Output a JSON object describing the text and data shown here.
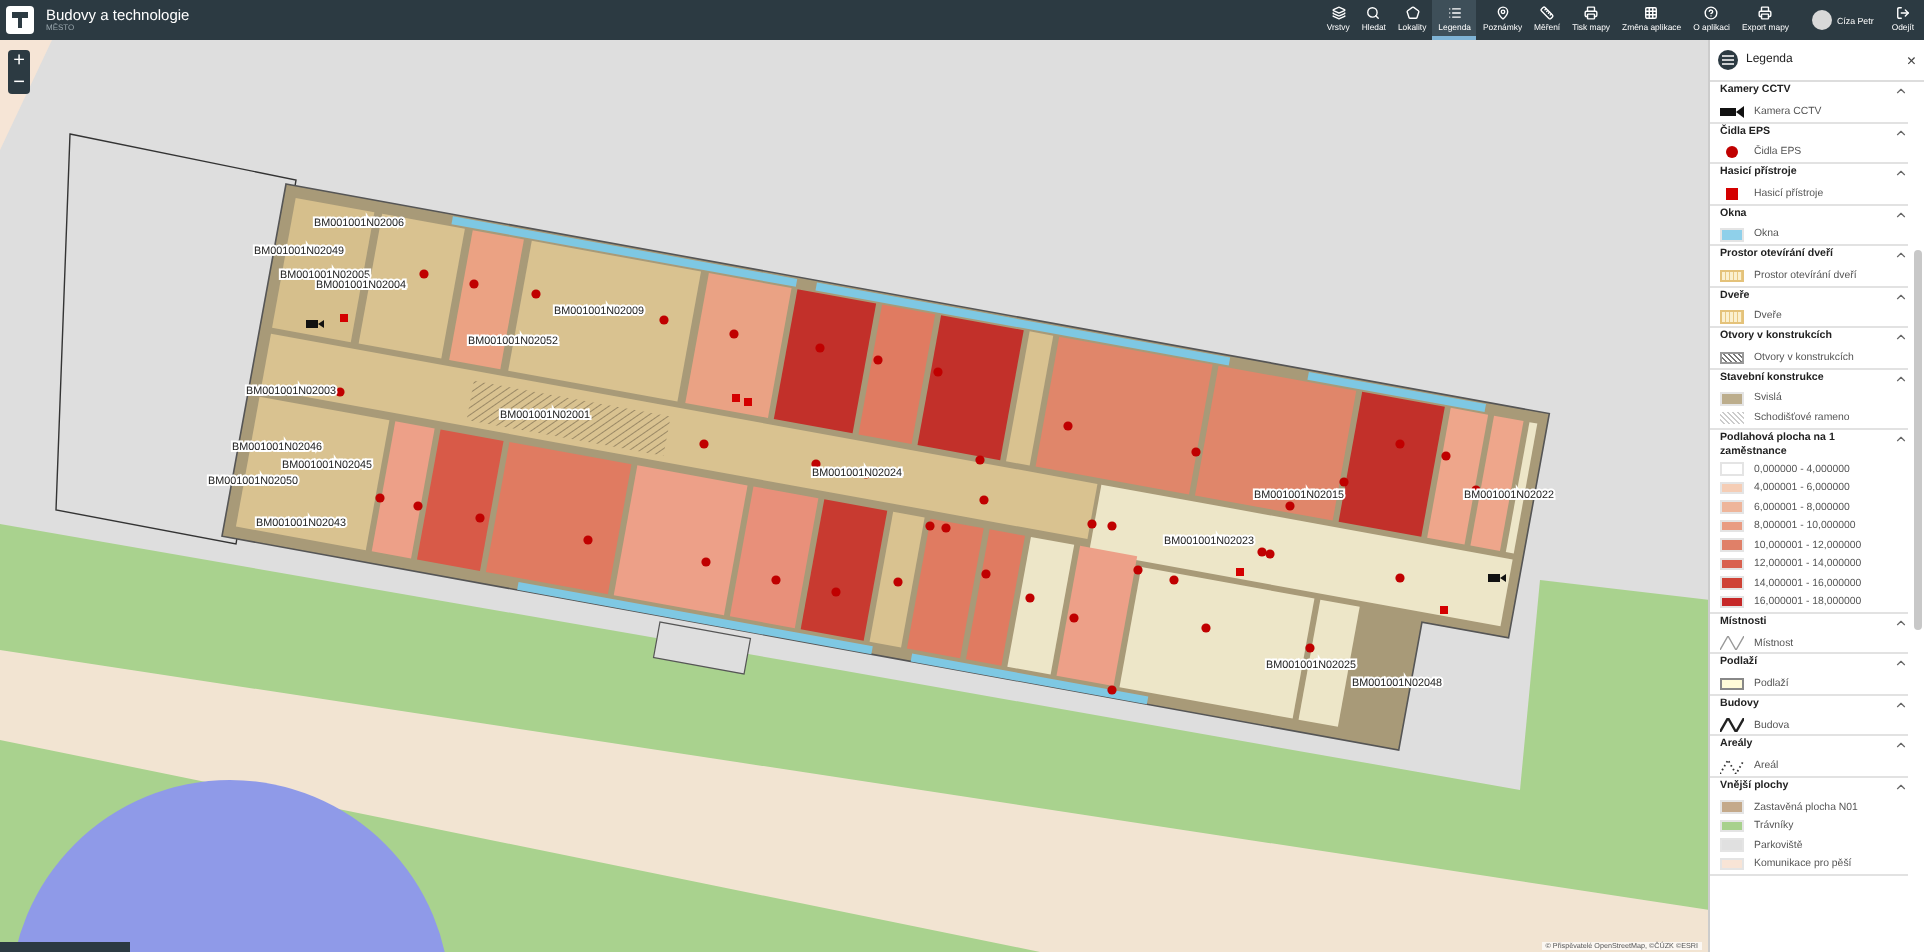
{
  "app": {
    "title": "Budovy a technologie",
    "subtitle": "MĚSTO"
  },
  "toolbar": [
    {
      "label": "Vrstvy",
      "selected": false
    },
    {
      "label": "Hledat",
      "selected": false
    },
    {
      "label": "Lokality",
      "selected": false
    },
    {
      "label": "Legenda",
      "selected": true
    },
    {
      "label": "Poznámky",
      "selected": false
    },
    {
      "label": "Měření",
      "selected": false
    },
    {
      "label": "Tisk mapy",
      "selected": false
    },
    {
      "label": "Změna aplikace",
      "selected": false
    },
    {
      "label": "O aplikaci",
      "selected": false
    },
    {
      "label": "Export mapy",
      "selected": false
    }
  ],
  "user": {
    "name": "Cíza Petr"
  },
  "logout": {
    "label": "Odejít"
  },
  "map": {
    "zoom_controls": [
      "+",
      "−"
    ],
    "room_labels": [
      "BM001001N02006",
      "BM001001N02049",
      "BM001001N02005",
      "BM001001N02004",
      "BM001001N02009",
      "BM001001N02052",
      "BM001001N02003",
      "BM001001N02001",
      "BM001001N02046",
      "BM001001N02045",
      "BM001001N02050",
      "BM001001N02043",
      "BM001001N02024",
      "BM001001N02023",
      "BM001001N02025",
      "BM001001N02048",
      "BM001001N02015",
      "BM001001N02022"
    ],
    "attribution": "© Přispěvatelé OpenStreetMap, ©ČÚZK ©ESRI"
  },
  "legend": {
    "title": "Legenda",
    "close": "×",
    "sections": [
      {
        "title": "Kamery CCTV",
        "expanded": true,
        "items": [
          {
            "kind": "camera",
            "label": "Kamera CCTV"
          }
        ]
      },
      {
        "title": "Čidla EPS",
        "expanded": true,
        "items": [
          {
            "kind": "dot",
            "label": "Čidla EPS",
            "color": "#c00000"
          }
        ]
      },
      {
        "title": "Hasicí přístroje",
        "expanded": true,
        "items": [
          {
            "kind": "square",
            "label": "Hasicí přístroje",
            "color": "#d40000"
          }
        ]
      },
      {
        "title": "Okna",
        "expanded": true,
        "items": [
          {
            "kind": "fill",
            "label": "Okna",
            "color": "#8fd0ea"
          }
        ]
      },
      {
        "title": "Prostor otevírání dveří",
        "expanded": true,
        "items": [
          {
            "kind": "door",
            "label": "Prostor otevírání dveří"
          }
        ]
      },
      {
        "title": "Dveře",
        "expanded": true,
        "items": [
          {
            "kind": "door",
            "label": "Dveře"
          }
        ]
      },
      {
        "title": "Otvory v konstrukcích",
        "expanded": true,
        "items": [
          {
            "kind": "opening",
            "label": "Otvory v konstrukcích"
          }
        ]
      },
      {
        "title": "Stavební konstrukce",
        "expanded": true,
        "items": [
          {
            "kind": "fill",
            "label": "Svislá",
            "color": "#bcad8c"
          },
          {
            "kind": "stair",
            "label": "Schodišťové rameno"
          }
        ]
      },
      {
        "title": "Podlahová plocha na 1 zaměstnance",
        "expanded": true,
        "items": [
          {
            "kind": "fill",
            "label": "0,000000 - 4,000000",
            "color": "#ffffff"
          },
          {
            "kind": "fill",
            "label": "4,000001 - 6,000000",
            "color": "#f5cdb5"
          },
          {
            "kind": "fill",
            "label": "6,000001 - 8,000000",
            "color": "#eeb59a"
          },
          {
            "kind": "fill",
            "label": "8,000001 - 10,000000",
            "color": "#e99c82"
          },
          {
            "kind": "fill",
            "label": "10,000001 - 12,000000",
            "color": "#e08068"
          },
          {
            "kind": "fill",
            "label": "12,000001 - 14,000000",
            "color": "#d9614f"
          },
          {
            "kind": "fill",
            "label": "14,000001 - 16,000000",
            "color": "#cf4236"
          },
          {
            "kind": "fill",
            "label": "16,000001 - 18,000000",
            "color": "#c62828"
          }
        ]
      },
      {
        "title": "Místnosti",
        "expanded": true,
        "items": [
          {
            "kind": "line",
            "label": "Místnost"
          }
        ]
      },
      {
        "title": "Podlaží",
        "expanded": true,
        "items": [
          {
            "kind": "outline",
            "label": "Podlaží",
            "color": "#fffbd8"
          }
        ]
      },
      {
        "title": "Budovy",
        "expanded": true,
        "items": [
          {
            "kind": "boldline",
            "label": "Budova"
          }
        ]
      },
      {
        "title": "Areály",
        "expanded": true,
        "items": [
          {
            "kind": "dots",
            "label": "Areál"
          }
        ]
      },
      {
        "title": "Vnější plochy",
        "expanded": true,
        "items": [
          {
            "kind": "fill",
            "label": "Zastavěná plocha N01",
            "color": "#c4a98a"
          },
          {
            "kind": "fill",
            "label": "Trávníky",
            "color": "#a8d18d"
          },
          {
            "kind": "fill",
            "label": "Parkoviště",
            "color": "#e0e0e0"
          },
          {
            "kind": "fill",
            "label": "Komunikace pro pěší",
            "color": "#f8e4d6"
          }
        ]
      }
    ]
  }
}
